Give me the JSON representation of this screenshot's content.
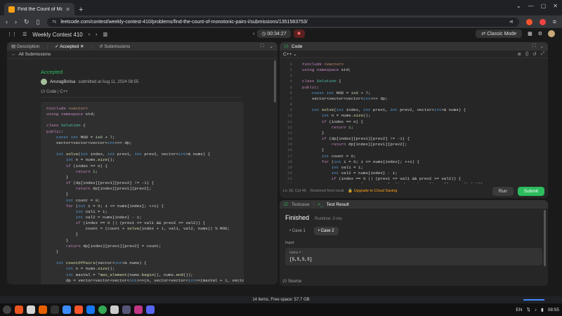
{
  "browser": {
    "tab_title": "Find the Count of Monotoni...",
    "new_tab": "+",
    "url": "leetcode.com/contest/weekly-contest-410/problems/find-the-count-of-monotonic-pairs-i/submissions/1351583753/"
  },
  "header": {
    "contest": "Weekly Contest 410",
    "timer": "00:34:27",
    "classic_mode": "Classic Mode"
  },
  "left": {
    "tabs": [
      "Description",
      "Accepted",
      "Submissions"
    ],
    "all_submissions": "All Submissions",
    "status": "Accepted",
    "author": "AnuragBorisa",
    "submitted": "submitted at Aug 11, 2024 08:55",
    "code_label": "Code",
    "lang": "C++"
  },
  "editor": {
    "title": "Code",
    "lang": "C++",
    "cursor": "Ln 18, Col 46",
    "restored": "Restored from local",
    "upgrade": "Upgrade to Cloud Saving",
    "run": "Run",
    "submit": "Submit"
  },
  "testcase": {
    "tab1": "Testcase",
    "tab2": "Test Result",
    "status": "Finished",
    "runtime": "Runtime: 0 ms",
    "case1": "Case 1",
    "case2": "Case 2",
    "input_label": "Input",
    "var_name": "nums =",
    "var_value": "[5,5,5,5]",
    "source": "Source"
  },
  "system": {
    "page_status": "14 items, Free space: 57.7 GB",
    "lang": "EN",
    "time": "08:55"
  }
}
